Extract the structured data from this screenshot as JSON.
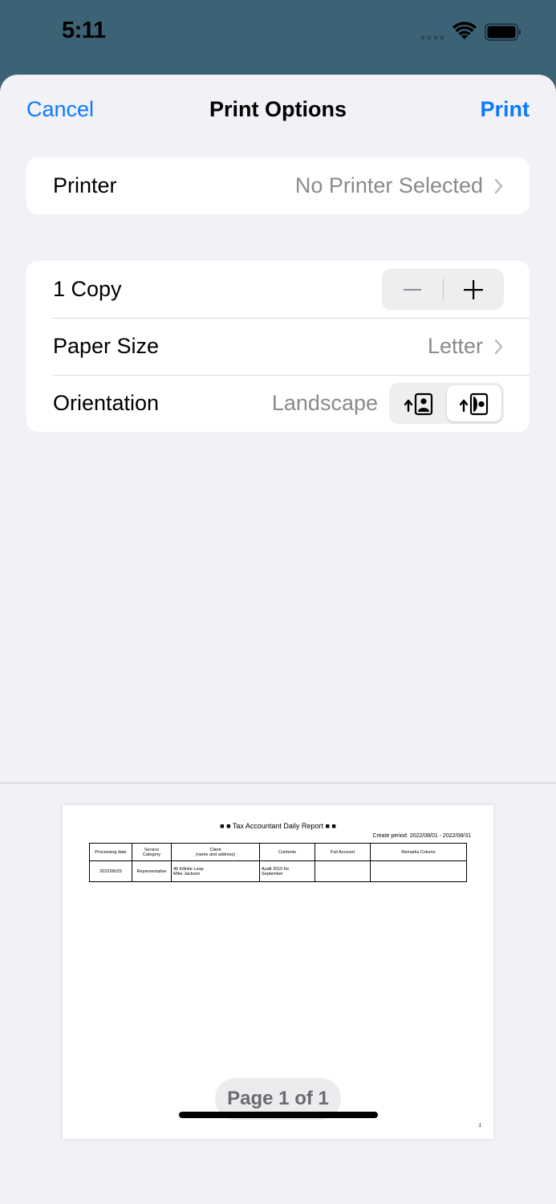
{
  "status": {
    "time": "5:11"
  },
  "nav": {
    "cancel": "Cancel",
    "title": "Print Options",
    "print": "Print"
  },
  "printer": {
    "label": "Printer",
    "value": "No Printer Selected"
  },
  "copies": {
    "label": "1 Copy"
  },
  "paper_size": {
    "label": "Paper Size",
    "value": "Letter"
  },
  "orientation": {
    "label": "Orientation",
    "value": "Landscape",
    "selected": "landscape"
  },
  "preview": {
    "report_title": "■ ■ Tax Accountant Daily Report ■ ■",
    "period": "Create period: 2022/08/01 - 2022/08/31",
    "headers": {
      "processing_date": "Processing date",
      "service_category_1": "Service",
      "service_category_2": "Category",
      "client_1": "Client",
      "client_2": "(name and address)",
      "contents": "Contents",
      "full_account": "Full Account",
      "remarks": "Remarks Column"
    },
    "row": {
      "processing_date": "2022/08/25",
      "service_category": "Representative",
      "client_address": "46 Infinite Loop",
      "client_name": "Mike Jackson",
      "contents_1": "Audit 2015 for",
      "contents_2": "September",
      "full_account": "",
      "remarks": ""
    },
    "page_number": "1",
    "page_indicator": "Page 1 of 1"
  },
  "colors": {
    "accent": "#0a7aff",
    "background": "#f2f1f6",
    "status_bar": "#3c6275"
  }
}
